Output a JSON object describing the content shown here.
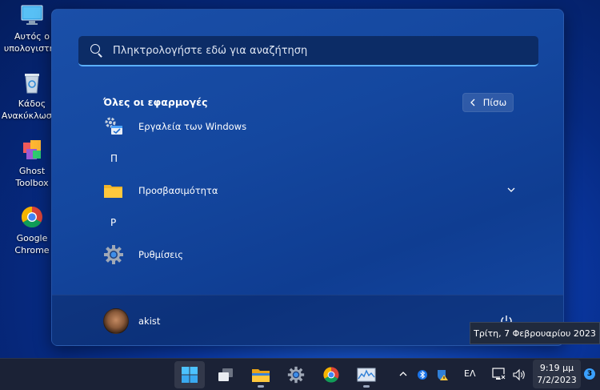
{
  "desktop": {
    "icons": [
      {
        "label_line1": "Αυτός ο",
        "label_line2": "υπολογιστής"
      },
      {
        "label_line1": "Κάδος",
        "label_line2": "Ανακύκλωσης"
      },
      {
        "label_line1": "Ghost",
        "label_line2": "Toolbox"
      },
      {
        "label_line1": "Google",
        "label_line2": "Chrome"
      }
    ]
  },
  "start_menu": {
    "search": {
      "placeholder": "Πληκτρολογήστε εδώ για αναζήτηση",
      "value": ""
    },
    "section_title": "Όλες οι εφαρμογές",
    "back_label": "Πίσω",
    "apps": [
      {
        "label": "Εργαλεία των Windows",
        "icon": "windows-tools-icon"
      },
      {
        "letter": "Π"
      },
      {
        "label": "Προσβασιμότητα",
        "icon": "folder-icon",
        "expandable": true
      },
      {
        "letter": "Ρ"
      },
      {
        "label": "Ρυθμίσεις",
        "icon": "settings-gear-icon"
      }
    ],
    "user": {
      "name": "akist"
    }
  },
  "tooltip": {
    "text": "Τρίτη, 7 Φεβρουαρίου 2023"
  },
  "taskbar": {
    "language": "ΕΛ",
    "time": "9:19 μμ",
    "date": "7/2/2023",
    "notification_count": "3"
  }
}
